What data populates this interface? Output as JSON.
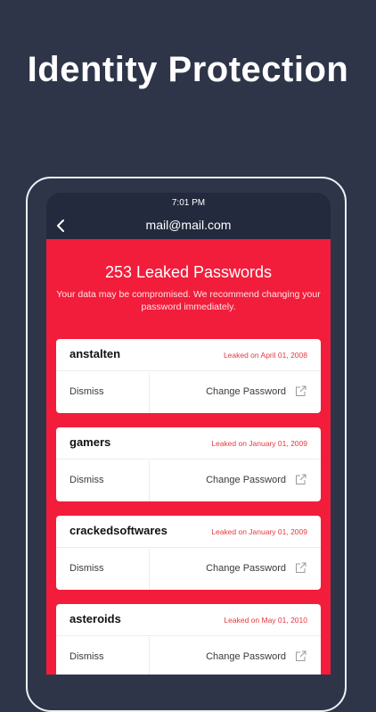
{
  "headline": "Identity Protection",
  "status_bar": {
    "time": "7:01 PM"
  },
  "nav": {
    "title": "mail@mail.com",
    "back_icon": "chevron-left-icon"
  },
  "summary": {
    "title": "253 Leaked Passwords",
    "description": "Your data may be compromised. We recommend changing your password immediately."
  },
  "colors": {
    "background": "#2e3549",
    "panel_red": "#f21d3b",
    "date_red": "#e5393f"
  },
  "leaks": [
    {
      "site": "anstalten",
      "date": "Leaked on April 01, 2008",
      "dismiss": "Dismiss",
      "change": "Change Password",
      "icon": "external-link-icon"
    },
    {
      "site": "gamers",
      "date": "Leaked on January 01, 2009",
      "dismiss": "Dismiss",
      "change": "Change Password",
      "icon": "external-link-icon"
    },
    {
      "site": "crackedsoftwares",
      "date": "Leaked on January 01, 2009",
      "dismiss": "Dismiss",
      "change": "Change Password",
      "icon": "external-link-icon"
    },
    {
      "site": "asteroids",
      "date": "Leaked on May 01, 2010",
      "dismiss": "Dismiss",
      "change": "Change Password",
      "icon": "external-link-icon"
    }
  ]
}
